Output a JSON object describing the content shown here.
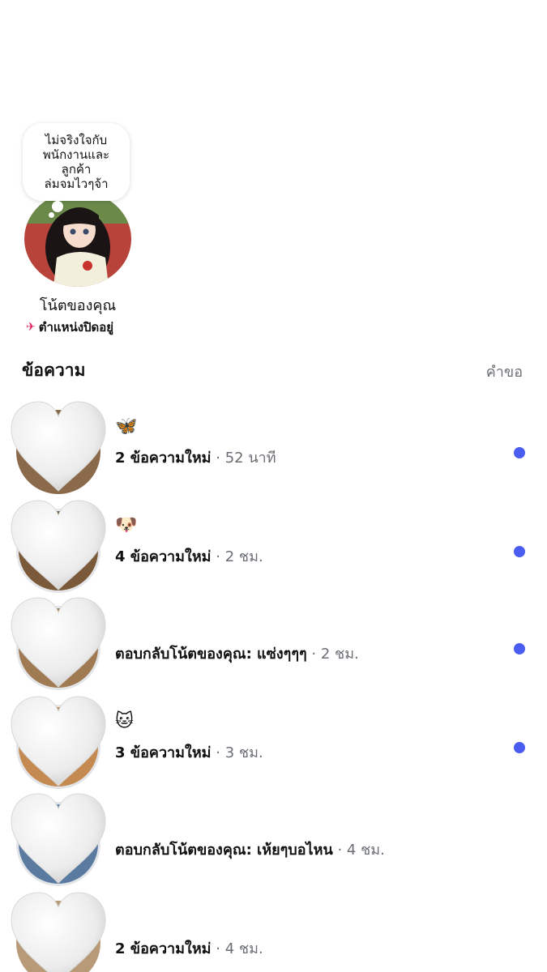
{
  "note": {
    "bubble_text": "ไม่จริงใจกับ\nพนักงานและ\nลูกค้า\nล่มจมไวๆจ้า",
    "label": "โน้ตของคุณ",
    "location_text": "ตำแหน่งปิดอยู่",
    "location_icon": "location-off-icon"
  },
  "messages_header": {
    "title": "ข้อความ",
    "requests_label": "คำขอ"
  },
  "threads": [
    {
      "emoji": "🦋",
      "main": "2 ข้อความใหม่",
      "time": " · 52 นาที",
      "unread": true
    },
    {
      "emoji": "🐶",
      "main": "4 ข้อความใหม่",
      "time": " · 2 ชม.",
      "unread": true
    },
    {
      "emoji": "",
      "main": "ตอบกลับโน้ตของคุณ: แซ่งๆๆๆ",
      "time": " · 2 ชม.",
      "unread": true
    },
    {
      "emoji": "🐱",
      "main": "3 ข้อความใหม่",
      "time": " · 3 ชม.",
      "unread": true
    },
    {
      "emoji": "",
      "main": "ตอบกลับโน้ตของคุณ: เห้ยๆบอไหน",
      "time": " · 4 ชม.",
      "unread": false
    },
    {
      "emoji": "",
      "main": "2 ข้อความใหม่",
      "time": " · 4 ชม.",
      "unread": false
    }
  ],
  "colors": {
    "accent_dot": "#4a5df0",
    "secondary_text": "#6b6f75"
  }
}
